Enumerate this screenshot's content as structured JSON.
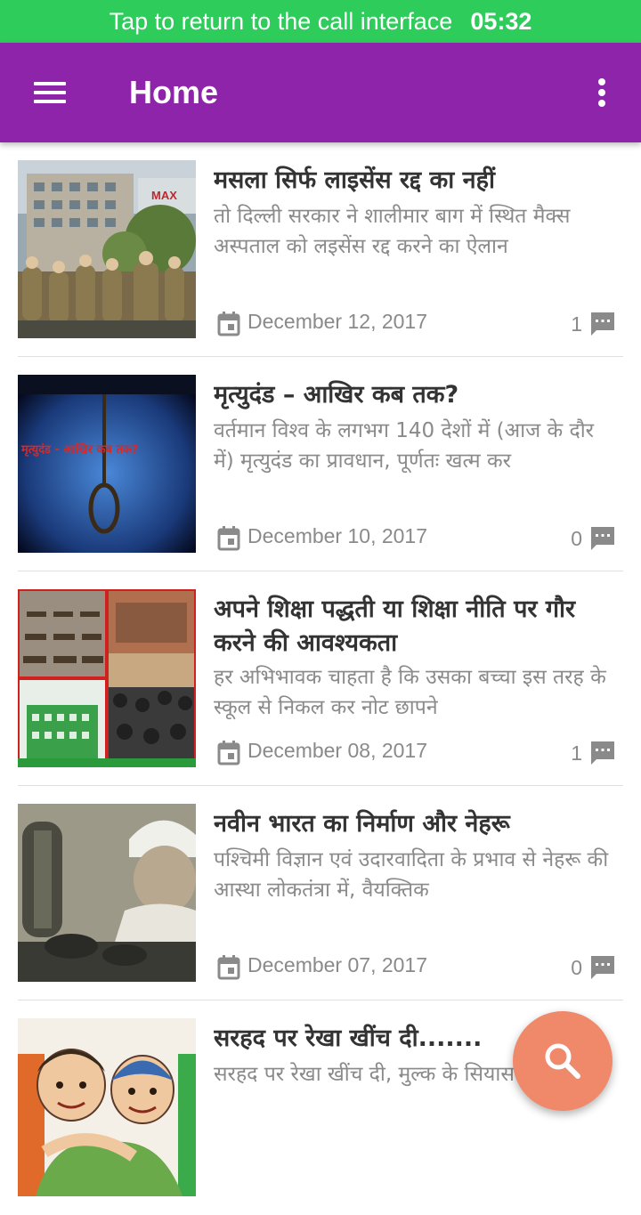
{
  "call_banner": {
    "message": "Tap to return to the call interface",
    "time": "05:32"
  },
  "app_bar": {
    "title": "Home",
    "menu_icon": "hamburger-menu-icon",
    "overflow_icon": "more-vert-icon",
    "color": "#8e24aa"
  },
  "posts": [
    {
      "title": "मसला सिर्फ लाइसेंस रद्द का नहीं",
      "excerpt": "तो दिल्ली सरकार ने शालीमार बाग में स्थित मैक्स अस्पताल को लइसेंस रद्द करने का ऐलान",
      "date": "December 12, 2017",
      "comments": "1",
      "thumbnail_text": "MAX"
    },
    {
      "title": "मृत्युदंड – आखिर कब तक?",
      "excerpt": "वर्तमान विश्व के लगभग 140 देशों में (आज के दौर में) मृत्युदंड का प्रावधान, पूर्णतः खत्म कर",
      "date": "December 10, 2017",
      "comments": "0",
      "thumbnail_text": "मृत्युदंड - आखिर कब तक?"
    },
    {
      "title": "अपने शिक्षा पद्धती या शिक्षा नीति पर गौर करने की आवश्यकता",
      "excerpt": "हर अभिभावक चाहता है कि उसका बच्चा इस तरह के स्कूल से निकल कर नोट छापने",
      "date": "December 08, 2017",
      "comments": "1"
    },
    {
      "title": "नवीन भारत का निर्माण और नेहरू",
      "excerpt": "पश्चिमी विज्ञान एवं उदारवादिता के प्रभाव से नेहरू की आस्था लोकतंत्रा में, वैयक्तिक",
      "date": "December 07, 2017",
      "comments": "0"
    },
    {
      "title": "सरहद पर रेखा खींच दी.......",
      "excerpt": "सरहद पर रेखा खींच दी, मुल्क के सियासतदानों में।",
      "date": "",
      "comments": ""
    }
  ],
  "fab": {
    "icon": "search-icon",
    "color": "#f0886a"
  }
}
